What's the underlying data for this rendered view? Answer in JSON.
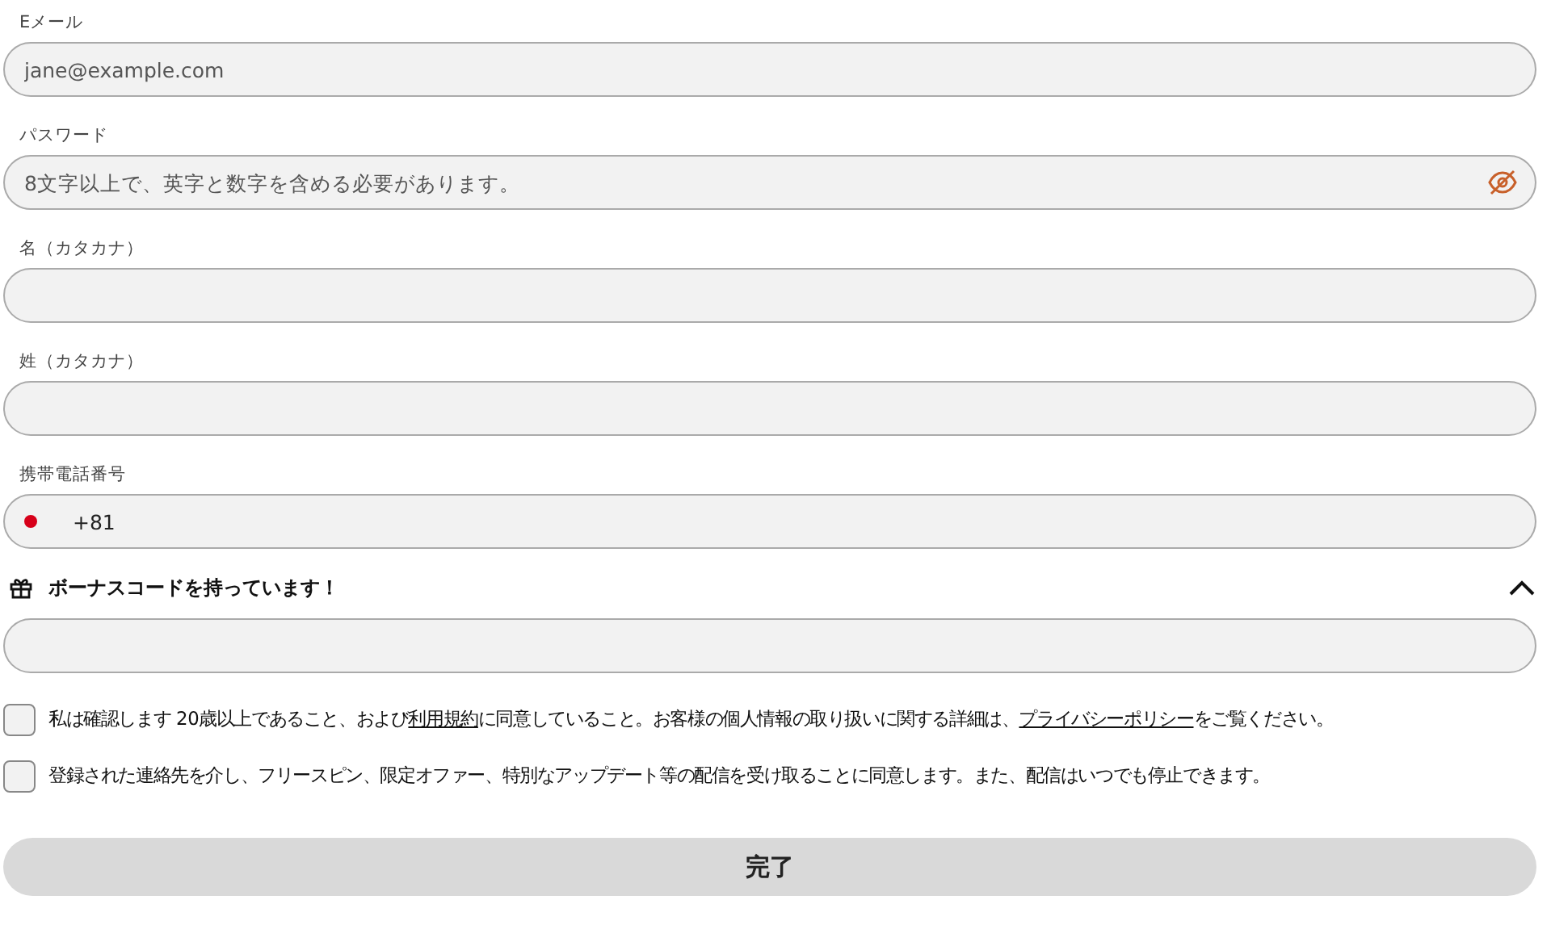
{
  "fields": [
    {
      "kind": "text",
      "label": "Eメール",
      "placeholder": "jane@example.com"
    },
    {
      "kind": "password",
      "label": "パスワード",
      "placeholder": "8文字以上で、英字と数字を含める必要があります。"
    },
    {
      "kind": "text",
      "label": "名（カタカナ）"
    },
    {
      "kind": "text",
      "label": "姓（カタカナ）"
    },
    {
      "kind": "phone",
      "label": "携帯電話番号",
      "value": "+81"
    }
  ],
  "bonus": {
    "label": "ボーナスコードを持っています！",
    "expanded": true
  },
  "consents": [
    {
      "checked": false,
      "parts": [
        {
          "kind": "text",
          "text": "私は確認します 20歳以上であること、および"
        },
        {
          "kind": "link",
          "text": "利用規約"
        },
        {
          "kind": "text",
          "text": "に同意していること。お客様の個人情報の取り扱いに関する詳細は、"
        },
        {
          "kind": "link",
          "text": "プライバシーポリシー"
        },
        {
          "kind": "text",
          "text": "をご覧ください。"
        }
      ]
    },
    {
      "checked": false,
      "parts": [
        {
          "kind": "text",
          "text": "登録された連絡先を介し、フリースピン、限定オファー、特別なアップデート等の配信を受け取ることに同意します。また、配信はいつでも停止できます。"
        }
      ]
    }
  ],
  "submit": "完了"
}
